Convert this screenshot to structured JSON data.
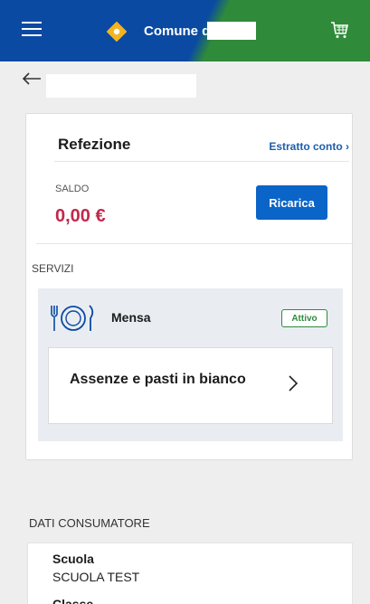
{
  "header": {
    "brand": "Comune di",
    "menu_icon": "hamburger-menu-icon",
    "cart_icon": "shopping-cart-icon",
    "colors": {
      "left": "#0b4aa2",
      "right": "#2f8a3a"
    }
  },
  "refezione": {
    "title": "Refezione",
    "estratto_link": "Estratto conto ›",
    "saldo_label": "SALDO",
    "saldo_value": "0,00 €",
    "ricarica_button": "Ricarica"
  },
  "servizi": {
    "title": "SERVIZI",
    "service_name": "Mensa",
    "service_status": "Attivo",
    "service_icon": "plate-cutlery-icon",
    "action_text": "Assenze e pasti in bianco"
  },
  "dati": {
    "title": "DATI CONSUMATORE",
    "scuola_label": "Scuola",
    "scuola_value": "SCUOLA TEST",
    "next_label": "Classe"
  }
}
